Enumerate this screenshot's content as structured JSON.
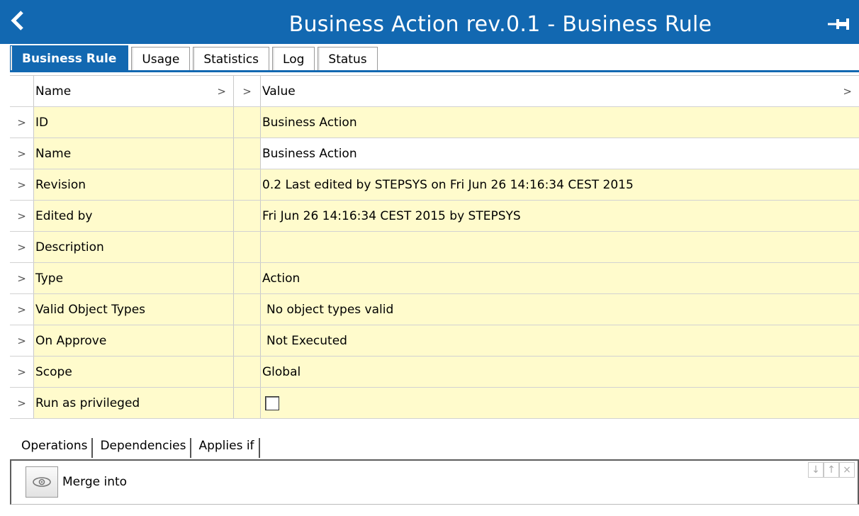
{
  "header": {
    "title": "Business Action rev.0.1 - Business Rule",
    "back_icon": "chevron-left-icon",
    "pin_icon": "pin-icon",
    "color": "#1268b1"
  },
  "tabs": [
    {
      "label": "Business Rule",
      "active": true
    },
    {
      "label": "Usage",
      "active": false
    },
    {
      "label": "Statistics",
      "active": false
    },
    {
      "label": "Log",
      "active": false
    },
    {
      "label": "Status",
      "active": false
    }
  ],
  "grid": {
    "columns": {
      "name": "Name",
      "value": "Value"
    },
    "rows": [
      {
        "name": "ID",
        "value": "Business Action"
      },
      {
        "name": "Name",
        "value": "Business Action"
      },
      {
        "name": "Revision",
        "value": "0.2 Last edited by STEPSYS on Fri Jun 26 14:16:34 CEST 2015"
      },
      {
        "name": "Edited by",
        "value": "Fri Jun 26 14:16:34 CEST 2015 by STEPSYS"
      },
      {
        "name": "Description",
        "value": ""
      },
      {
        "name": "Type",
        "value": "Action"
      },
      {
        "name": "Valid Object Types",
        "value": "No object types valid"
      },
      {
        "name": "On Approve",
        "value": "Not Executed"
      },
      {
        "name": "Scope",
        "value": "Global"
      },
      {
        "name": "Run as privileged",
        "value": "",
        "checkbox": false
      }
    ]
  },
  "subtabs": [
    {
      "label": "Operations",
      "active": true
    },
    {
      "label": "Dependencies",
      "active": false
    },
    {
      "label": "Applies if",
      "active": false
    }
  ],
  "operations": {
    "items": [
      {
        "label": "Merge  into",
        "icon": "eye-icon"
      }
    ],
    "controls": [
      "↓",
      "↑",
      "×"
    ]
  }
}
